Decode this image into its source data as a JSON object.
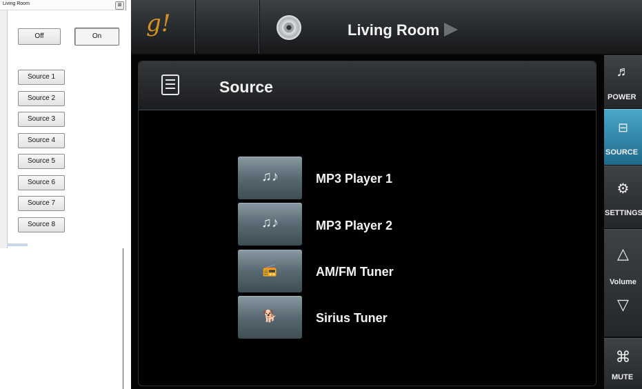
{
  "small_window": {
    "title": "Living Room",
    "close_glyph": "⊠",
    "off_label": "Off",
    "on_label": "On",
    "sources": [
      "Source 1",
      "Source 2",
      "Source 3",
      "Source 4",
      "Source 5",
      "Source 6",
      "Source 7",
      "Source 8"
    ]
  },
  "app": {
    "logo": "g!",
    "room_title": "Living Room",
    "panel_title": "Source",
    "sources": [
      {
        "label": "MP3 Player 1",
        "icon": "music-notes-icon",
        "glyph": "♫♪"
      },
      {
        "label": "MP3 Player 2",
        "icon": "music-notes-icon",
        "glyph": "♫♪"
      },
      {
        "label": "AM/FM Tuner",
        "icon": "radio-icon",
        "glyph": "📻"
      },
      {
        "label": "Sirius Tuner",
        "icon": "dog-icon",
        "glyph": "🐕"
      }
    ],
    "sidebar": {
      "power": "POWER",
      "source": "SOURCE",
      "settings": "SETTINGS",
      "volume": "Volume",
      "mute": "MUTE"
    },
    "colors": {
      "accent": "#2a86ab",
      "logo": "#d99222"
    }
  }
}
